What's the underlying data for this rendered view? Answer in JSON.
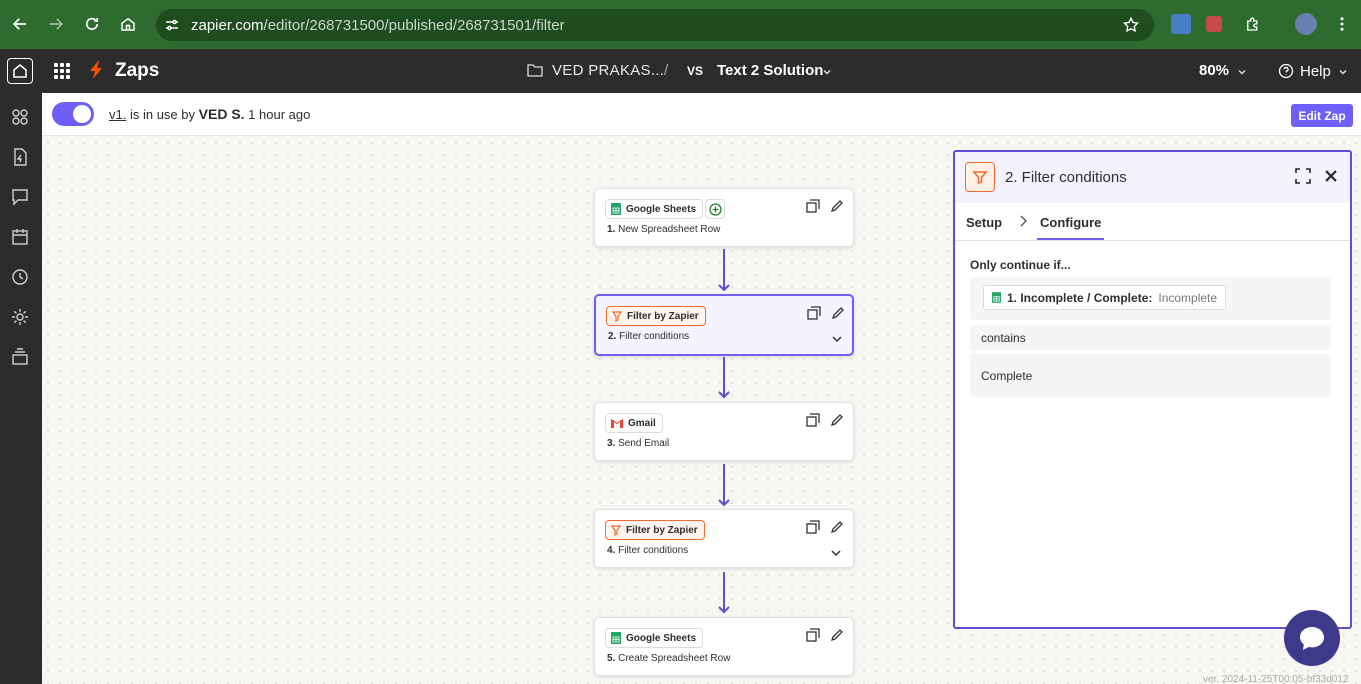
{
  "browser": {
    "url_host": "zapier.com",
    "url_path": "/editor/268731500/published/268731501/filter"
  },
  "header": {
    "app_name": "Zaps",
    "folder_name": "VED PRAKAS...",
    "separator": "/",
    "owner_initials": "VS",
    "zap_name": "Text 2 Solution",
    "zoom": "80%",
    "help": "Help"
  },
  "status": {
    "version": "v1.",
    "in_use_text": "is in use by",
    "user": "VED S.",
    "time": "1 hour ago",
    "toggle_on": true,
    "edit_button": "Edit Zap"
  },
  "steps": [
    {
      "app": "Google Sheets",
      "number": "1.",
      "title": "New Spreadsheet Row",
      "icon": "google-sheets-icon"
    },
    {
      "app": "Filter by Zapier",
      "number": "2.",
      "title": "Filter conditions",
      "icon": "filter-icon"
    },
    {
      "app": "Gmail",
      "number": "3.",
      "title": "Send Email",
      "icon": "gmail-icon"
    },
    {
      "app": "Filter by Zapier",
      "number": "4.",
      "title": "Filter conditions",
      "icon": "filter-icon"
    },
    {
      "app": "Google Sheets",
      "number": "5.",
      "title": "Create Spreadsheet Row",
      "icon": "google-sheets-icon"
    }
  ],
  "panel": {
    "title": "2. Filter conditions",
    "tabs": [
      "Setup",
      "Configure"
    ],
    "active_tab": "Configure",
    "condition_label": "Only continue if...",
    "field_name": "1. Incomplete / Complete:",
    "field_value": "Incomplete",
    "operator": "contains",
    "value": "Complete"
  },
  "footer": {
    "version": "ver. 2024-11-25T00:05-bf33d012"
  },
  "colors": {
    "accent": "#6d5ff7",
    "connector": "#5b4fd3",
    "filter_orange": "#f46b2f",
    "browser_green": "#2e6b2e",
    "header_dark": "#2c2c2c"
  }
}
